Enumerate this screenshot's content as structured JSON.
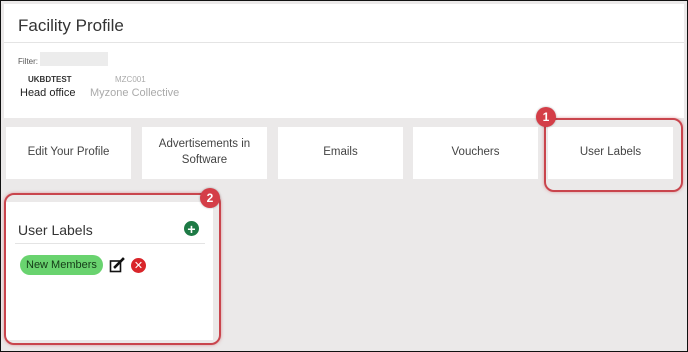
{
  "page": {
    "title": "Facility Profile",
    "filter_label": "Filter:",
    "filter_value": ""
  },
  "facilities": [
    {
      "code": "UKBDTEST",
      "name": "Head office"
    },
    {
      "code": "MZC001",
      "name": "Myzone Collective"
    }
  ],
  "tabs": [
    {
      "label": "Edit Your Profile"
    },
    {
      "label": "Advertisements in Software"
    },
    {
      "label": "Emails"
    },
    {
      "label": "Vouchers"
    },
    {
      "label": "User Labels"
    }
  ],
  "user_labels": {
    "title": "User Labels",
    "add_icon": "plus-circle-icon",
    "items": [
      {
        "label": "New Members",
        "edit_icon": "edit-icon",
        "delete_icon": "delete-x-icon"
      }
    ]
  },
  "annotations": [
    {
      "number": "1"
    },
    {
      "number": "2"
    }
  ],
  "colors": {
    "highlight": "#c9454d",
    "label_chip": "#69d36f",
    "add_button": "#1e7a45",
    "delete_button": "#d9252a"
  }
}
